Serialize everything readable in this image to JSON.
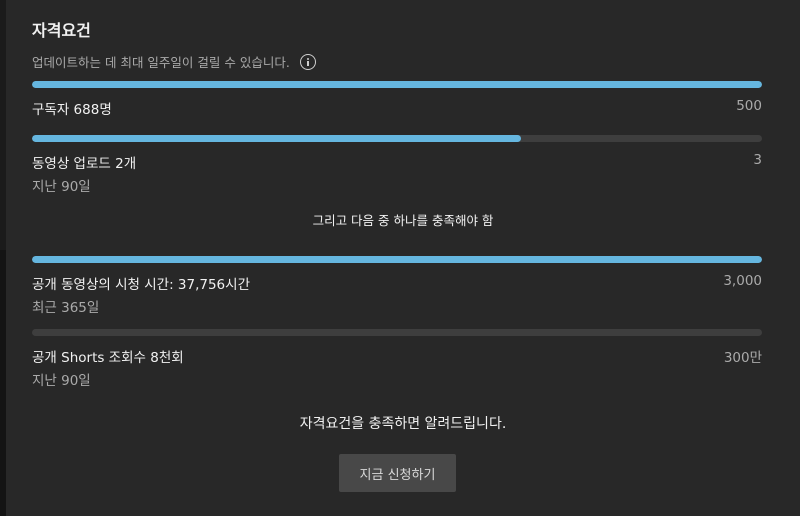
{
  "header": {
    "title": "자격요건",
    "subtitle": "업데이트하는 데 최대 일주일이 걸릴 수 있습니다."
  },
  "requirements": [
    {
      "label": "구독자 688명",
      "target": "500",
      "sub": "",
      "progress": 1.0
    },
    {
      "label": "동영상 업로드 2개",
      "target": "3",
      "sub": "지난 90일",
      "progress": 0.67
    }
  ],
  "or_text": "그리고 다음 중 하나를 충족해야 함",
  "alternatives": [
    {
      "label": "공개 동영상의 시청 시간: 37,756시간",
      "target": "3,000",
      "sub": "최근 365일",
      "progress": 1.0
    },
    {
      "label": "공개 Shorts 조회수 8천회",
      "target": "300만",
      "sub": "지난 90일",
      "progress": 0.0
    }
  ],
  "footer": {
    "notify": "자격요건을 충족하면 알려드립니다.",
    "apply_label": "지금 신청하기"
  },
  "colors": {
    "accent": "#65b6df",
    "track": "#3e3e3e",
    "background": "#282828"
  }
}
